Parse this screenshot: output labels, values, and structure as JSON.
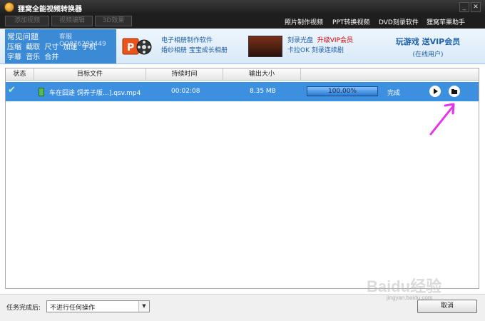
{
  "window": {
    "title": "狸窝全能视频转换器",
    "minimize_icon": "minimize-icon",
    "close_icon": "close-icon"
  },
  "toolbar": {
    "add_video": "添加视频",
    "edit_video": "视频编辑",
    "effect_3d": "3D效果",
    "links": [
      "照片制作视频",
      "PPT转换视频",
      "DVD刻录软件",
      "狸窝苹果助手"
    ]
  },
  "banner": {
    "faq_title": "常见问题",
    "customer_service": "客服QQ876292449",
    "faq_links_row1": [
      "压缩",
      "截取",
      "尺寸",
      "加速",
      "手机"
    ],
    "faq_links_row2": [
      "字幕",
      "音乐",
      "合并"
    ],
    "promo1_line1": "电子相册制作软件",
    "promo1_line2": "婚纱相册  宝宝成长相册",
    "promo2_line1a": "刻录光盘",
    "promo2_line1b": "升级VIP会员",
    "promo2_line2": "卡拉OK  刻录连续剧",
    "promo3_title": "玩游戏  送VIP会员",
    "promo3_sub": "(在线用户)"
  },
  "grid": {
    "headers": [
      "状态",
      "目标文件",
      "持续时间",
      "输出大小",
      ""
    ],
    "rows": [
      {
        "status_icon": "check-icon",
        "file_icon": "video-file-icon",
        "filename": "车在囧途 饲养子版…].qsv.mp4",
        "duration": "00:02:08",
        "size": "8.35 MB",
        "progress": 1.0,
        "progress_text": "100.00%",
        "status": "完成",
        "play_icon": "play-icon",
        "folder_icon": "open-folder-icon"
      }
    ]
  },
  "annotation": {
    "arrow_color": "#e834e8"
  },
  "bottom": {
    "after_label": "任务完成后:",
    "after_value": "不进行任何操作",
    "cancel": "取消"
  },
  "watermark": {
    "main": "Baidu经验",
    "sub": "jingyan.baidu.com"
  }
}
